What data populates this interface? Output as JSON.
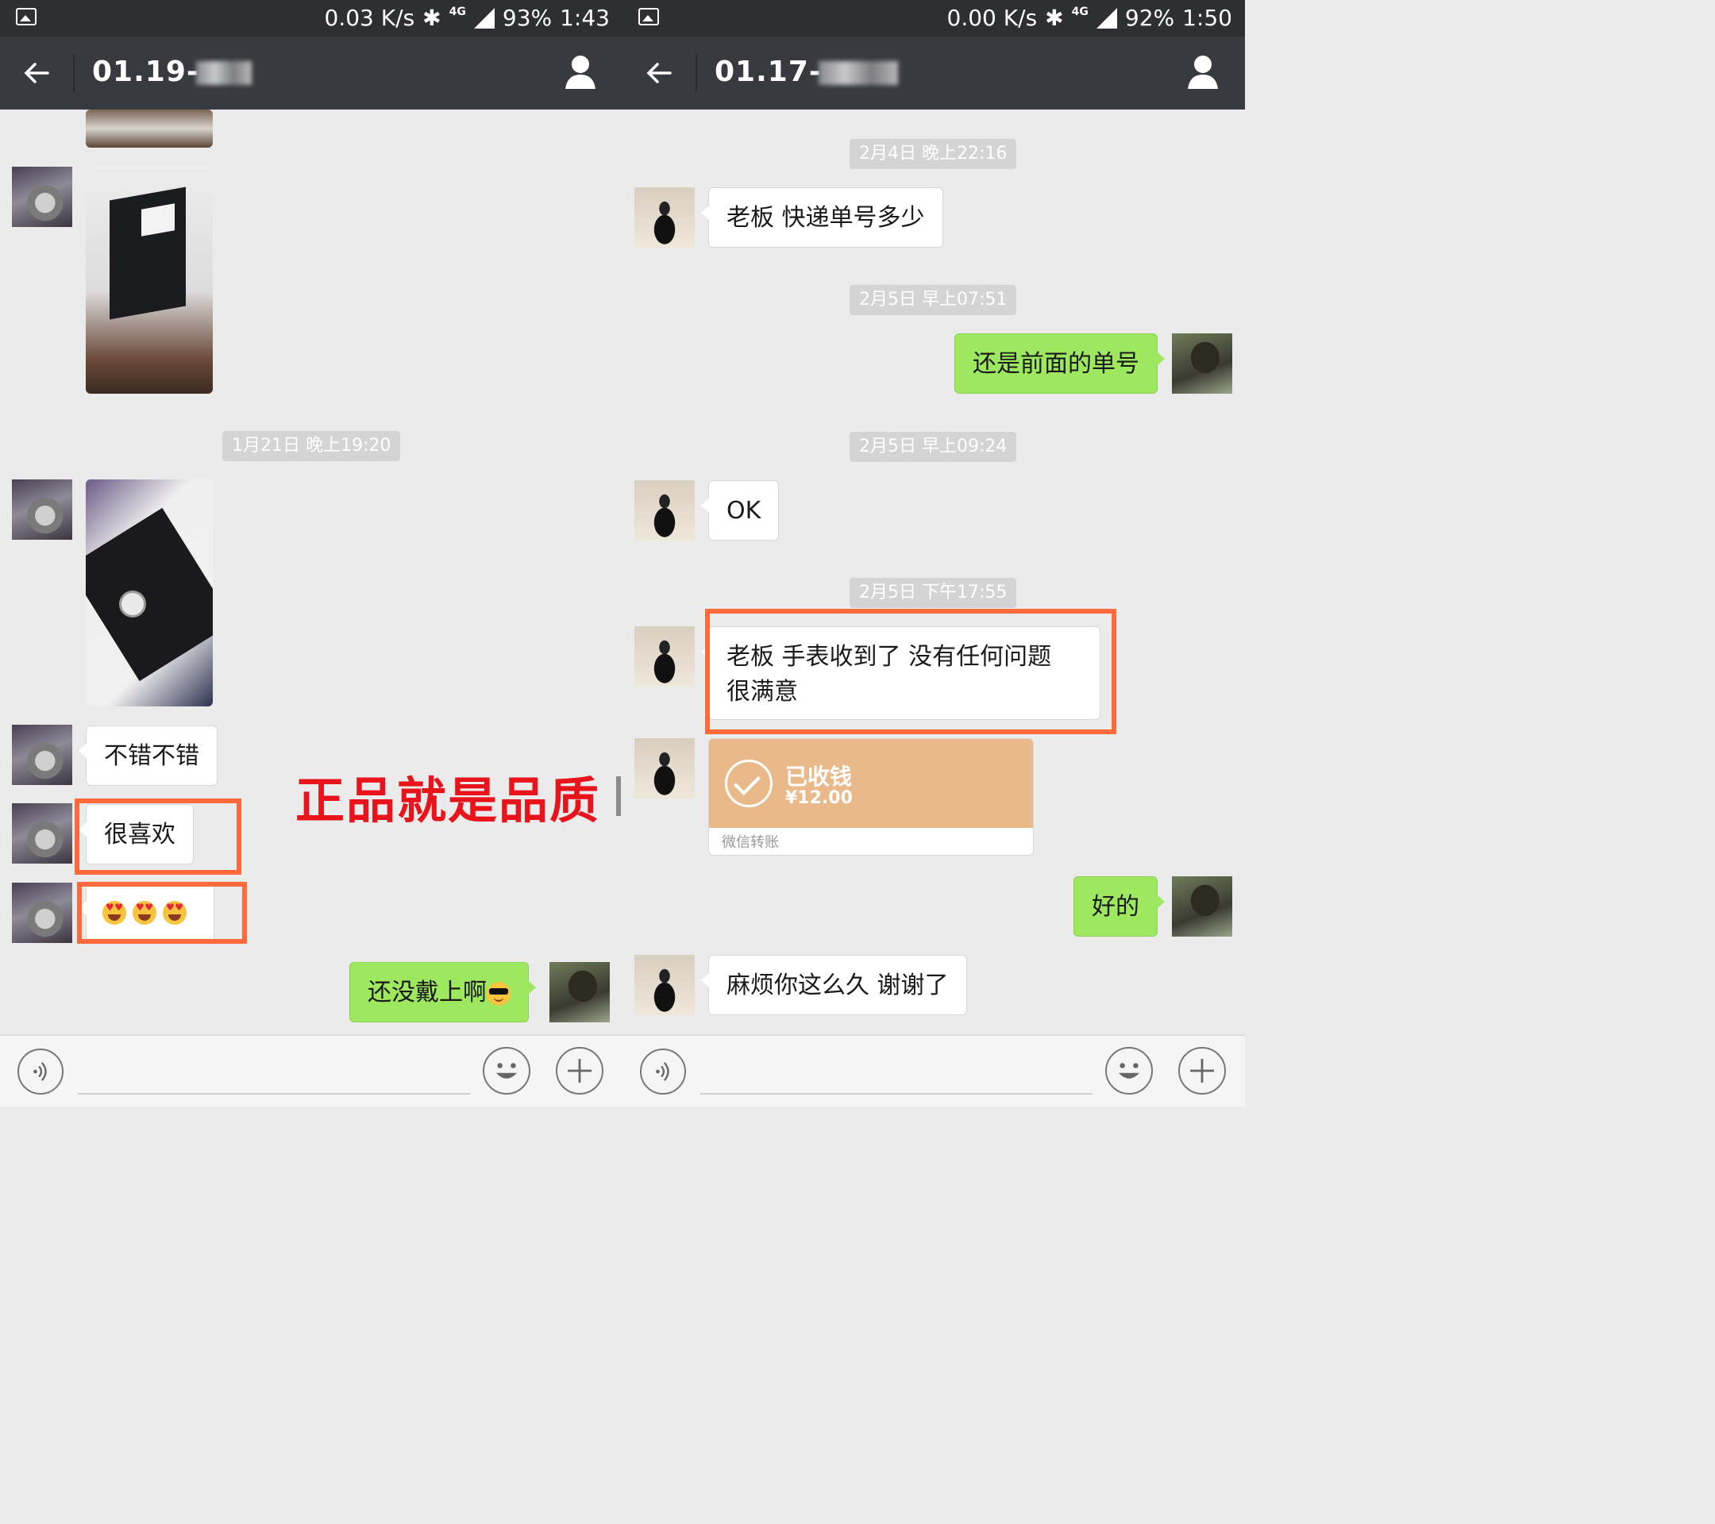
{
  "left": {
    "status": {
      "speed": "0.03 K/s",
      "network": "4G",
      "battery": "93%",
      "time": "1:43"
    },
    "title": "01.19-",
    "timestamps": [
      "1月21日 晚上19:20"
    ],
    "messages": {
      "m1": "不错不错",
      "m2": "很喜欢",
      "m3": "还没戴上啊"
    },
    "caption": "正品就是品质"
  },
  "right": {
    "status": {
      "speed": "0.00 K/s",
      "network": "4G",
      "battery": "92%",
      "time": "1:50"
    },
    "title": "01.17-",
    "timestamps": [
      "2月4日 晚上22:16",
      "2月5日 早上07:51",
      "2月5日 早上09:24",
      "2月5日 下午17:55"
    ],
    "messages": {
      "m1": "老板 快递单号多少",
      "m2": "还是前面的单号",
      "m3": "OK",
      "m4": "老板 手表收到了 没有任何问题 很满意",
      "m5": "好的",
      "m6": "麻烦你这么久 谢谢了"
    },
    "transfer": {
      "title": "已收钱",
      "amount": "¥12.00",
      "footer": "微信转账"
    }
  },
  "colors": {
    "highlight": "#ff6a3d",
    "caption": "#e8131b",
    "bubble_out": "#9ee85f",
    "transfer": "#e9b989"
  },
  "icons": [
    "back-arrow-icon",
    "profile-icon",
    "voice-icon",
    "emoji-icon",
    "plus-icon",
    "image-notification-icon",
    "bluetooth-icon",
    "signal-icon"
  ]
}
